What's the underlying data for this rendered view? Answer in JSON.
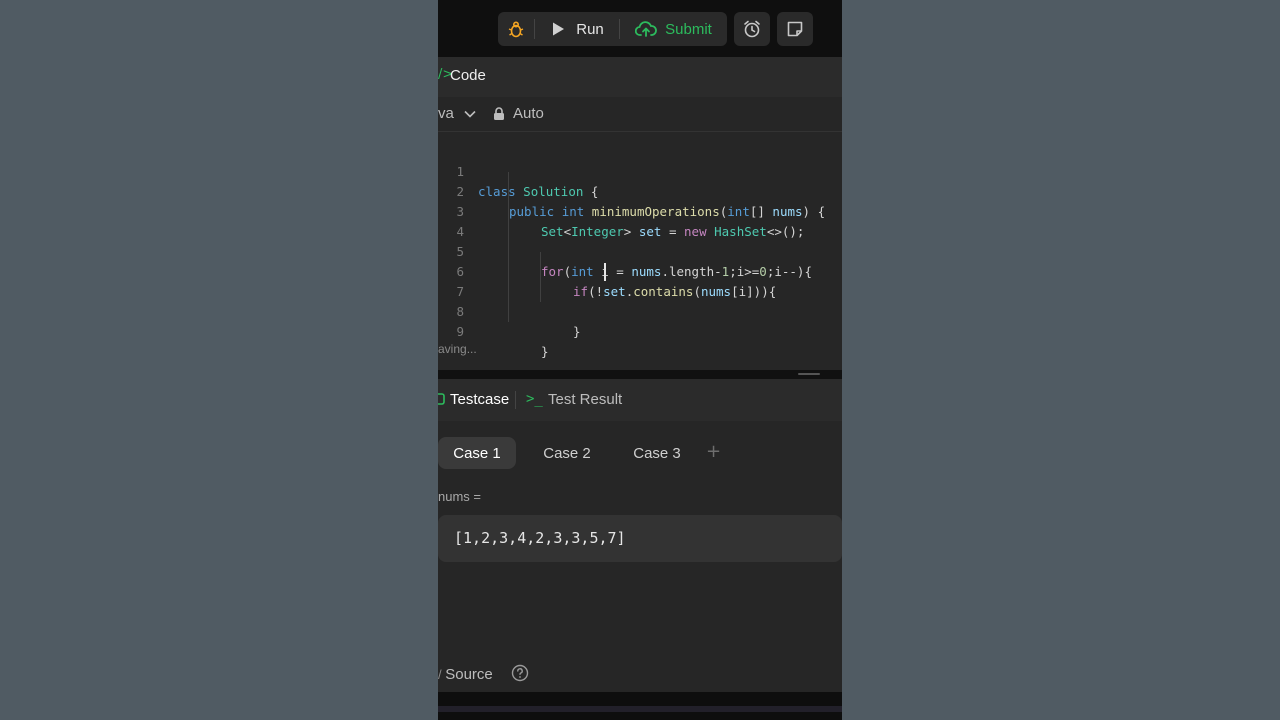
{
  "toolbar": {
    "run_label": "Run",
    "submit_label": "Submit",
    "colors": {
      "submit": "#2cbb5d",
      "debug": "#f5a623"
    }
  },
  "code_panel": {
    "title": "Code",
    "language": "va",
    "mode": "Auto",
    "status": "aving...",
    "lines": [
      {
        "n": "1"
      },
      {
        "n": "2"
      },
      {
        "n": "3"
      },
      {
        "n": "4"
      },
      {
        "n": "5"
      },
      {
        "n": "6"
      },
      {
        "n": "7"
      },
      {
        "n": "8"
      },
      {
        "n": "9"
      }
    ],
    "tokens": {
      "l1": [
        "class",
        "Solution",
        "{"
      ],
      "l2": [
        "public",
        "int",
        "minimumOperations",
        "(",
        "int",
        "[] ",
        "nums",
        ") {"
      ],
      "l3": [
        "Set",
        "<",
        "Integer",
        "> ",
        "set",
        " = ",
        "new",
        " ",
        "HashSet",
        "<>();"
      ],
      "l5": [
        "for",
        "(",
        "int",
        " i = ",
        "nums",
        ".length-",
        "1",
        ";i>=",
        "0",
        ";i--){"
      ],
      "l6": [
        "if",
        "(!",
        "set",
        ".",
        "contains",
        "(",
        "nums",
        "[i])){"
      ],
      "l8": [
        "}"
      ],
      "l9": [
        "}"
      ]
    }
  },
  "test_panel": {
    "tab_testcase": "Testcase",
    "tab_result": "Test Result",
    "cases": [
      "Case 1",
      "Case 2",
      "Case 3"
    ],
    "add": "+",
    "param_label": "nums =",
    "param_value": "[1,2,3,4,2,3,3,5,7]",
    "source_label": "Source"
  }
}
